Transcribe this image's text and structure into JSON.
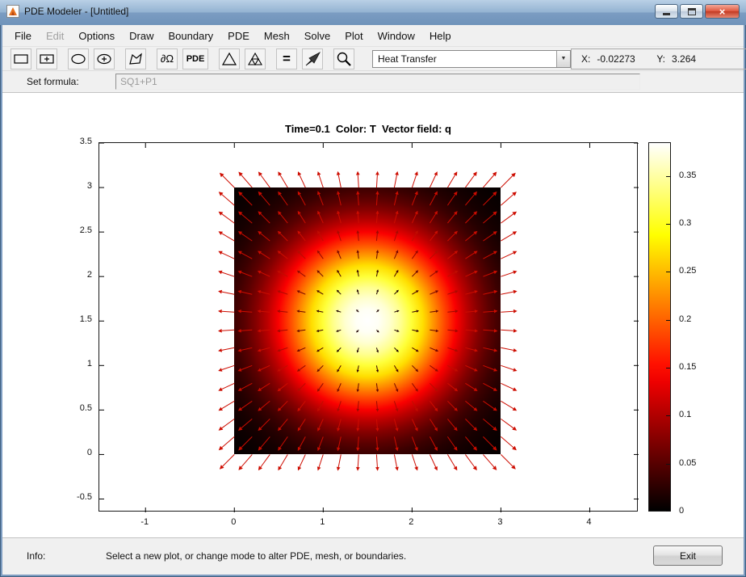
{
  "window": {
    "title": "PDE Modeler - [Untitled]",
    "close_glyph": "×",
    "control_icons": [
      "minimize-icon",
      "maximize-icon",
      "close-icon"
    ]
  },
  "menu": {
    "items": [
      {
        "label": "File",
        "enabled": true
      },
      {
        "label": "Edit",
        "enabled": false
      },
      {
        "label": "Options",
        "enabled": true
      },
      {
        "label": "Draw",
        "enabled": true
      },
      {
        "label": "Boundary",
        "enabled": true
      },
      {
        "label": "PDE",
        "enabled": true
      },
      {
        "label": "Mesh",
        "enabled": true
      },
      {
        "label": "Solve",
        "enabled": true
      },
      {
        "label": "Plot",
        "enabled": true
      },
      {
        "label": "Window",
        "enabled": true
      },
      {
        "label": "Help",
        "enabled": true
      }
    ]
  },
  "toolbar": {
    "icons": {
      "rectangle-tool": "rectangle outline",
      "rectangle-centered-tool": "rectangle with plus",
      "ellipse-tool": "ellipse outline",
      "ellipse-centered-tool": "ellipse with plus",
      "polygon-tool": "polygon outline",
      "mesh-init": "triangle",
      "mesh-refine": "subdivided triangle",
      "plot-solution": "3d-plot-arrow",
      "zoom": "magnifier"
    },
    "boundary_label": "∂Ω",
    "pde_label": "PDE",
    "solve_label": "=",
    "mode_select_value": "Heat Transfer",
    "coords": {
      "x_label": "X:",
      "x_value": "-0.02273",
      "y_label": "Y:",
      "y_value": "3.264"
    }
  },
  "formula": {
    "label": "Set formula:",
    "value": "SQ1+P1"
  },
  "statusbar": {
    "info_label": "Info:",
    "message": "Select a new plot, or change mode to alter PDE, mesh, or boundaries.",
    "exit_label": "Exit"
  },
  "chart_data": {
    "type": "heatmap+quiver",
    "title": "Time=0.1  Color: T  Vector field: q",
    "xlim": [
      -1.52,
      4.55
    ],
    "ylim": [
      -0.65,
      3.5
    ],
    "x_ticks": [
      -1,
      0,
      1,
      2,
      3,
      4
    ],
    "y_ticks": [
      -0.5,
      0,
      0.5,
      1,
      1.5,
      2,
      2.5,
      3,
      3.5
    ],
    "grid": false,
    "domain": {
      "shape": "square",
      "x0": 0,
      "y0": 0,
      "x1": 3,
      "y1": 3
    },
    "hot_spot": {
      "x": 1.5,
      "y": 1.5,
      "falloff_radius": 1.0,
      "exponent": 2.2
    },
    "colormap": "hot",
    "colorbar": {
      "min": 0,
      "max": 0.385,
      "ticks": [
        0,
        0.05,
        0.1,
        0.15,
        0.2,
        0.25,
        0.3,
        0.35
      ],
      "position": "right"
    },
    "quiver": {
      "nx": 16,
      "ny": 16,
      "center_x": 1.5,
      "center_y": 1.5,
      "direction": "radial-outward",
      "color": "#cc0000"
    }
  }
}
